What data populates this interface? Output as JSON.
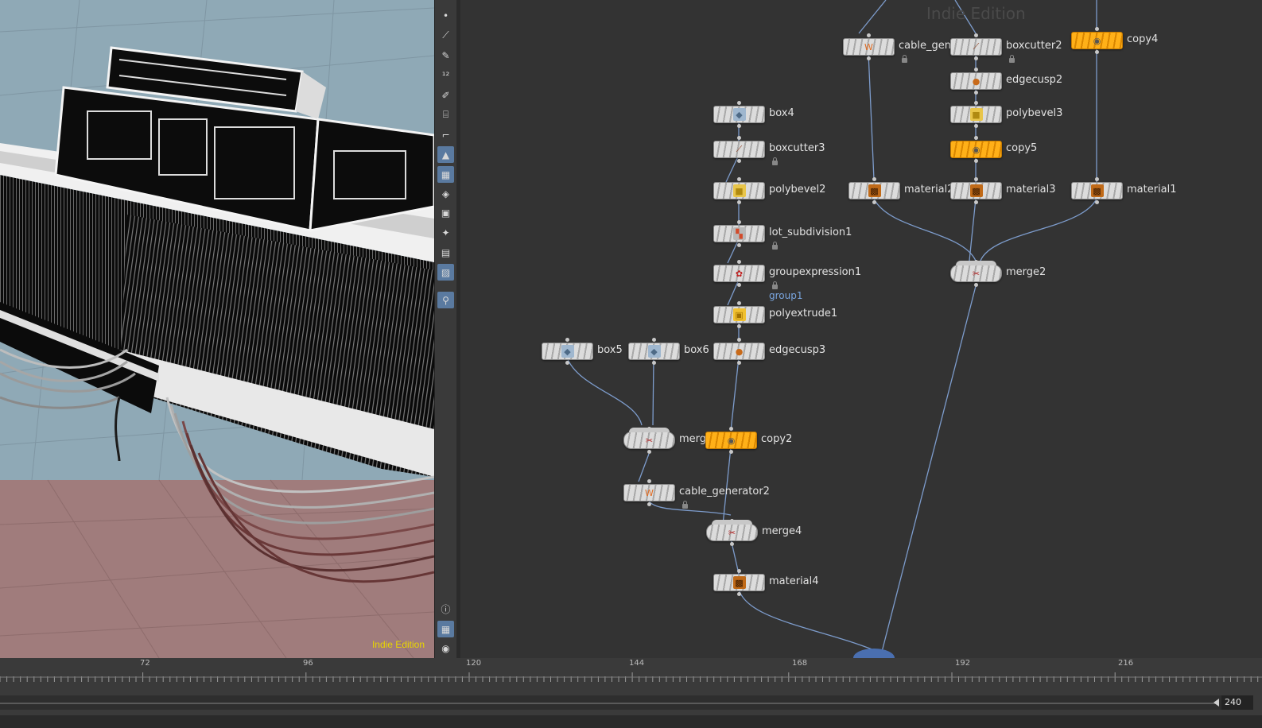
{
  "viewport": {
    "watermark": "Indie Edition",
    "colors": {
      "sky": "#8fa9b6",
      "ground": "#a07c7c",
      "geometry": "#0b0b0b",
      "wireframe": "#f2f2f2",
      "cables": "#5a3030"
    }
  },
  "toolbar": {
    "items": [
      {
        "name": "point-icon",
        "glyph": "•"
      },
      {
        "name": "line-icon",
        "glyph": "⟋"
      },
      {
        "name": "pen-icon",
        "glyph": "✎"
      },
      {
        "name": "measure-icon",
        "glyph": "¹²"
      },
      {
        "name": "brush-icon",
        "glyph": "✐"
      },
      {
        "name": "stamp-icon",
        "glyph": "⌸"
      },
      {
        "name": "corner-icon",
        "glyph": "⌐"
      },
      {
        "name": "camera-icon",
        "glyph": "▲",
        "active": true
      },
      {
        "name": "texture-icon",
        "glyph": "▦",
        "active": true
      },
      {
        "name": "layer-icon",
        "glyph": "◈"
      },
      {
        "name": "frame-icon",
        "glyph": "▣"
      },
      {
        "name": "light-icon",
        "glyph": "✦"
      },
      {
        "name": "display-icon",
        "glyph": "▤"
      },
      {
        "name": "background-icon",
        "glyph": "▨",
        "active": true
      },
      {
        "name": "pin-icon",
        "glyph": "⚲",
        "active": true
      },
      {
        "name": "info-icon",
        "glyph": "ⓘ"
      },
      {
        "name": "grid-icon",
        "glyph": "▦",
        "active": true
      },
      {
        "name": "eye-icon",
        "glyph": "◉"
      }
    ]
  },
  "network": {
    "watermark": "Indie Edition",
    "wire_color": "#7d9ccc",
    "nodes": [
      {
        "id": "cable_gene",
        "label": "cable_gene",
        "type": "cable",
        "orange": false,
        "locked": true
      },
      {
        "id": "boxcutter2",
        "label": "boxcutter2",
        "type": "cutter",
        "orange": false,
        "locked": true
      },
      {
        "id": "copy4",
        "label": "copy4",
        "type": "copy",
        "orange": true
      },
      {
        "id": "edgecusp2",
        "label": "edgecusp2",
        "type": "edgecusp",
        "orange": false
      },
      {
        "id": "box4",
        "label": "box4",
        "type": "box",
        "orange": false
      },
      {
        "id": "polybevel3",
        "label": "polybevel3",
        "type": "bevel",
        "orange": false
      },
      {
        "id": "boxcutter3",
        "label": "boxcutter3",
        "type": "cutter",
        "orange": false,
        "locked": true
      },
      {
        "id": "copy5",
        "label": "copy5",
        "type": "copy",
        "orange": true
      },
      {
        "id": "polybevel2",
        "label": "polybevel2",
        "type": "bevel",
        "orange": false
      },
      {
        "id": "material2",
        "label": "material2",
        "type": "material",
        "orange": false
      },
      {
        "id": "material3",
        "label": "material3",
        "type": "material",
        "orange": false
      },
      {
        "id": "material1",
        "label": "material1",
        "type": "material",
        "orange": false
      },
      {
        "id": "lot_subdivision1",
        "label": "lot_subdivision1",
        "type": "lot",
        "orange": false,
        "locked": true
      },
      {
        "id": "groupexpression1",
        "label": "groupexpression1",
        "type": "group",
        "orange": false,
        "locked": true,
        "group": "group1"
      },
      {
        "id": "merge2",
        "label": "merge2",
        "type": "merge",
        "orange": false
      },
      {
        "id": "polyextrude1",
        "label": "polyextrude1",
        "type": "extrude",
        "orange": false
      },
      {
        "id": "box5",
        "label": "box5",
        "type": "box",
        "orange": false
      },
      {
        "id": "box6",
        "label": "box6",
        "type": "box",
        "orange": false
      },
      {
        "id": "edgecusp3",
        "label": "edgecusp3",
        "type": "edgecusp",
        "orange": false
      },
      {
        "id": "merge3",
        "label": "merge3",
        "type": "merge",
        "orange": false
      },
      {
        "id": "copy2",
        "label": "copy2",
        "type": "copy",
        "orange": true
      },
      {
        "id": "cable_generator2",
        "label": "cable_generator2",
        "type": "cable",
        "orange": false,
        "locked": true
      },
      {
        "id": "merge4",
        "label": "merge4",
        "type": "merge",
        "orange": false
      },
      {
        "id": "material4",
        "label": "material4",
        "type": "material",
        "orange": false
      }
    ]
  },
  "timeline": {
    "tick_labels": [
      "72",
      "96",
      "120",
      "144",
      "168",
      "192",
      "216"
    ],
    "end_frame": "240"
  }
}
